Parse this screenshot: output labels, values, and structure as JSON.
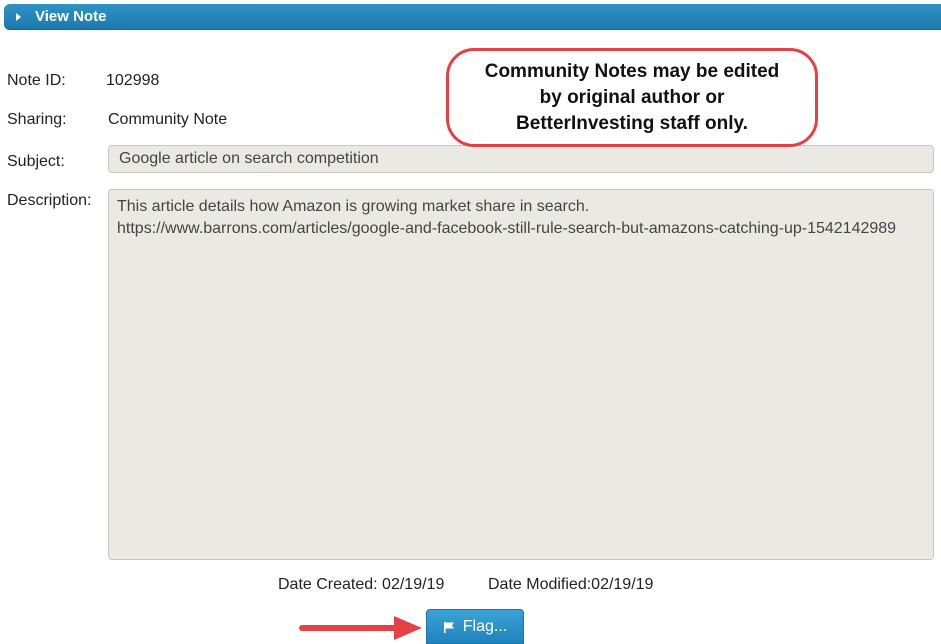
{
  "panel": {
    "title": "View Note"
  },
  "fields": {
    "note_id_label": "Note ID:",
    "note_id_value": "102998",
    "sharing_label": "Sharing:",
    "sharing_value": "Community Note",
    "subject_label": "Subject:",
    "subject_value": "Google article on search competition",
    "description_label": "Description:",
    "description_value": "This article details how Amazon is growing market share in search.\nhttps://www.barrons.com/articles/google-and-facebook-still-rule-search-but-amazons-catching-up-1542142989"
  },
  "callout": {
    "text": "Community Notes may be edited by original author or BetterInvesting staff only."
  },
  "dates": {
    "created": "Date Created: 02/19/19",
    "modified": "Date Modified:02/19/19"
  },
  "actions": {
    "flag_label": "Flag..."
  },
  "colors": {
    "header": "#1c78ad",
    "callout_border": "#e34146",
    "arrow": "#e34146"
  }
}
